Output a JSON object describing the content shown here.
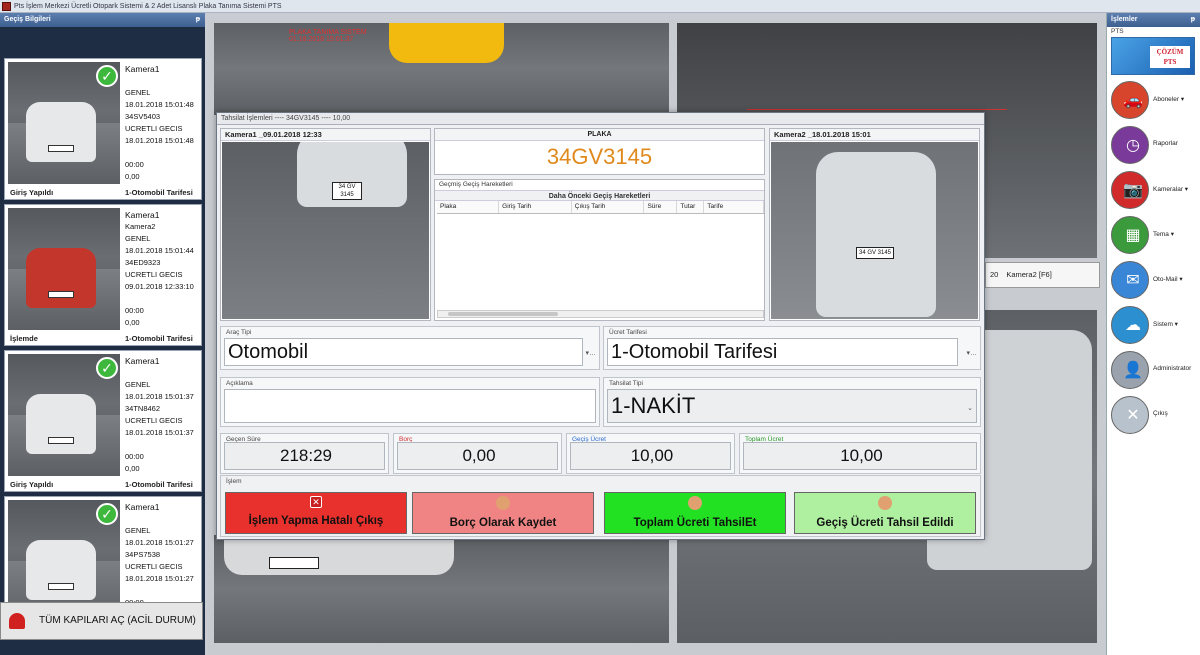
{
  "window": {
    "title": "Pts İşlem Merkezi Ücretli Otopark Sistemi & 2 Adet Lisanslı Plaka Tanıma Sistemi PTS"
  },
  "left_panel": {
    "title": "Geçiş Bilgileri",
    "pin": "ᵽ",
    "cards": [
      {
        "camera": "Kamera1",
        "camera2": "",
        "type": "GENEL",
        "date1": "18.01.2018 15:01:48",
        "plate": "34SV5403",
        "kind": "UCRETLI GECIS",
        "date2": "18.01.2018 15:01:48",
        "time": "00:00",
        "amount": "0,00",
        "status": "Giriş Yapıldı",
        "tariff": "1-Otomobil Tarifesi",
        "checked": true,
        "car_color": "white"
      },
      {
        "camera": "Kamera1",
        "camera2": "Kamera2",
        "type": "GENEL",
        "date1": "18.01.2018 15:01:44",
        "plate": "34ED9323",
        "kind": "UCRETLI GECIS",
        "date2": "09.01.2018 12:33:10",
        "time": "00:00",
        "amount": "0,00",
        "status": "İşlemde",
        "tariff": "1-Otomobil Tarifesi",
        "checked": false,
        "car_color": "red"
      },
      {
        "camera": "Kamera1",
        "camera2": "",
        "type": "GENEL",
        "date1": "18.01.2018 15:01:37",
        "plate": "34TN8462",
        "kind": "UCRETLI GECIS",
        "date2": "18.01.2018 15:01:37",
        "time": "00:00",
        "amount": "0,00",
        "status": "Giriş Yapıldı",
        "tariff": "1-Otomobil Tarifesi",
        "checked": true,
        "car_color": "white"
      },
      {
        "camera": "Kamera1",
        "camera2": "",
        "type": "GENEL",
        "date1": "18.01.2018 15:01:27",
        "plate": "34PS7538",
        "kind": "UCRETLI GECIS",
        "date2": "18.01.2018 15:01:27",
        "time": "00:00",
        "amount": "",
        "status": "",
        "tariff": "",
        "checked": true,
        "car_color": "white"
      }
    ],
    "emergency_label": "TÜM KAPILARI AÇ (ACİL DURUM)"
  },
  "camera_bg": {
    "top_left_overlay": "PLAKA TANIMA SISTEM\n01.18.2018 15:01:37",
    "right_bar": {
      "num": "20",
      "label": "Kamera2 [F6]"
    }
  },
  "right_panel": {
    "title": "İşlemler",
    "pin": "ᵽ",
    "sub": "PTS",
    "logo_text": "ÇÖZÜM\nPTS",
    "items": [
      {
        "label": "Aboneler ▾",
        "color": "#d6452c",
        "glyph": "🚗"
      },
      {
        "label": "Raporlar",
        "color": "#7a3a9a",
        "glyph": "◷"
      },
      {
        "label": "Kameralar ▾",
        "color": "#d12a2a",
        "glyph": "📷"
      },
      {
        "label": "Tema ▾",
        "color": "#3b9a3b",
        "glyph": "▦"
      },
      {
        "label": "Oto-Mail ▾",
        "color": "#3a86d6",
        "glyph": "✉"
      },
      {
        "label": "Sistem ▾",
        "color": "#2c8fd0",
        "glyph": "☁"
      },
      {
        "label": "Administrator",
        "color": "#9aa2ad",
        "glyph": "👤"
      },
      {
        "label": "Çıkış",
        "color": "#b8c2cc",
        "glyph": "✕"
      }
    ]
  },
  "modal": {
    "title": "Tahsilat İşlemleri ---- 34GV3145 ---- 10,00",
    "cam1_caption": "Kamera1 _09.01.2018 12:33",
    "cam2_caption": "Kamera2 _18.01.2018 15:01",
    "cam_plate": "34 GV 3145",
    "plaka_label": "PLAKA",
    "plaka_value": "34GV3145",
    "history_caption": "Geçmiş Geçiş Hareketleri",
    "history_title": "Daha Önceki Geçiş Hareketleri",
    "history_columns": [
      "Plaka",
      "Giriş Tarih",
      "Çıkış Tarih",
      "Süre",
      "Tutar",
      "Tarife"
    ],
    "arac_tipi_label": "Araç Tipi",
    "arac_tipi_value": "Otomobil",
    "ucret_tarifesi_label": "Ücret Tarifesi",
    "ucret_tarifesi_value": "1-Otomobil Tarifesi",
    "aciklama_label": "Açıklama",
    "aciklama_value": "",
    "tahsilat_tipi_label": "Tahsilat Tipi",
    "tahsilat_tipi_value": "1-NAKİT",
    "gecen_sure_label": "Geçen Süre",
    "gecen_sure_value": "218:29",
    "borc_label": "Borç",
    "borc_value": "0,00",
    "gecis_ucret_label": "Geçiş Ücret",
    "gecis_ucret_value": "10,00",
    "toplam_ucret_label": "Toplam Ücret",
    "toplam_ucret_value": "10,00",
    "islem_label": "İşlem",
    "buttons": {
      "hatali_cikis": "İşlem Yapma Hatalı Çıkış",
      "borc_kaydet": "Borç Olarak Kaydet",
      "toplam_tahsil": "Toplam Ücreti TahsilEt",
      "gecis_tahsil": "Geçiş Ücreti Tahsil Edildi"
    },
    "colors": {
      "borc_label": "#d0282a",
      "gecis_label": "#2a6ad0",
      "toplam_label": "#2a9a2a",
      "btn_red": "#e8302c",
      "btn_pink": "#f08484",
      "btn_green": "#22e022",
      "btn_lightgreen": "#aef0a0"
    }
  }
}
